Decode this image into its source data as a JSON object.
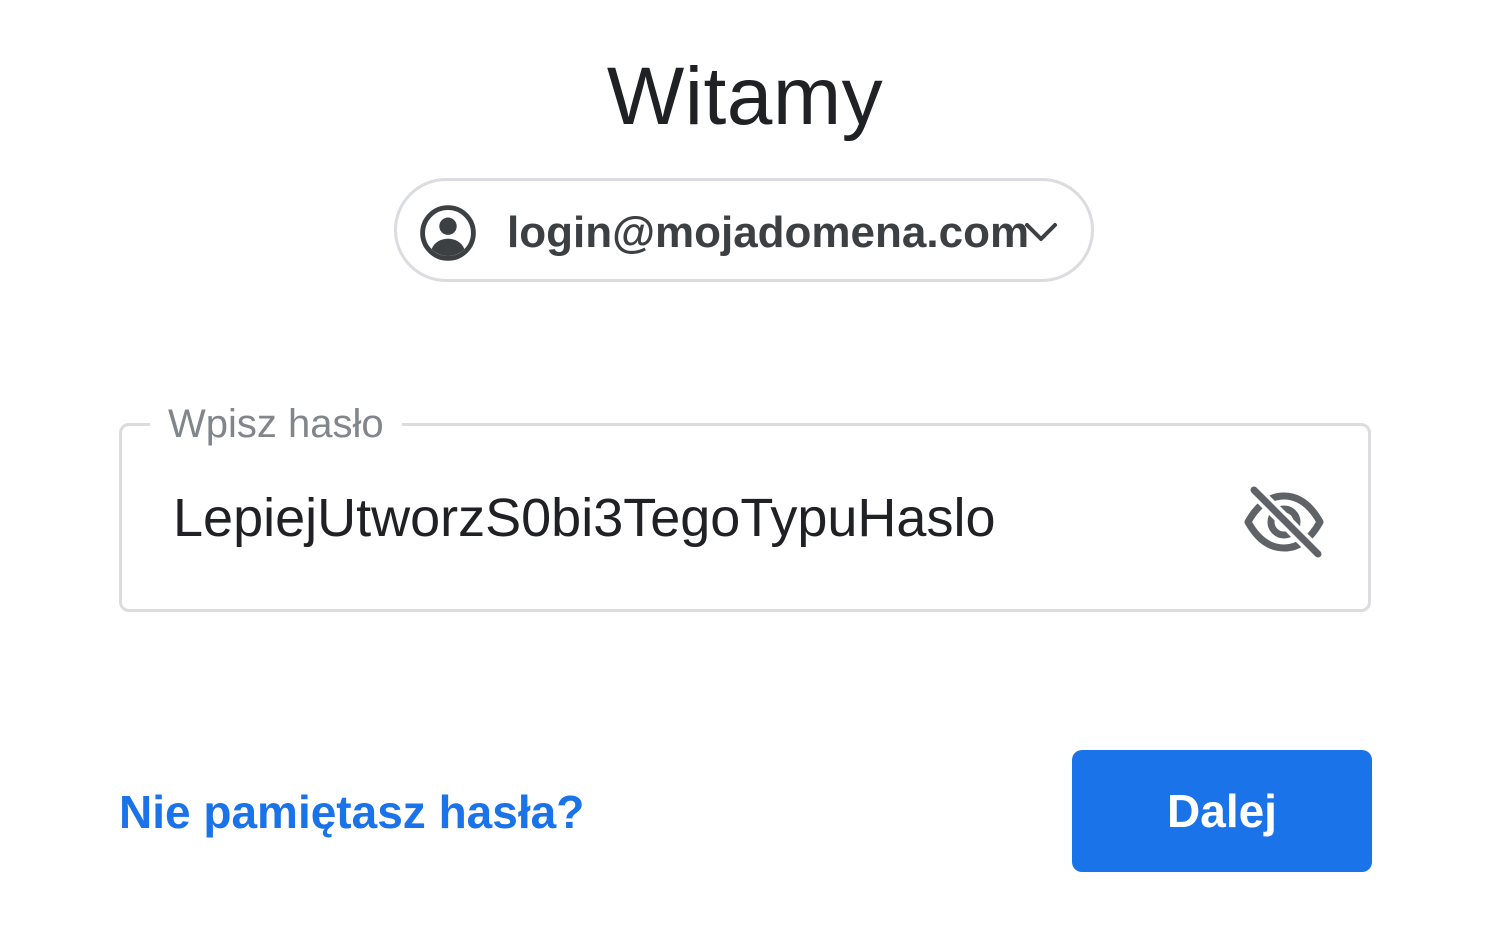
{
  "header": {
    "title": "Witamy"
  },
  "account": {
    "email": "login@mojadomena.com",
    "avatar_icon": "account-circle-icon",
    "dropdown_icon": "chevron-down-icon"
  },
  "password": {
    "label": "Wpisz hasło",
    "value": "LepiejUtworzS0bi3TegoTypuHaslo",
    "visibility_icon": "visibility-off-icon"
  },
  "actions": {
    "forgot_label": "Nie pamiętasz hasła?",
    "next_label": "Dalej"
  },
  "colors": {
    "accent": "#1a73e8",
    "border": "#dadce0",
    "text": "#202124",
    "label": "#80868b",
    "icon": "#5f6368"
  }
}
